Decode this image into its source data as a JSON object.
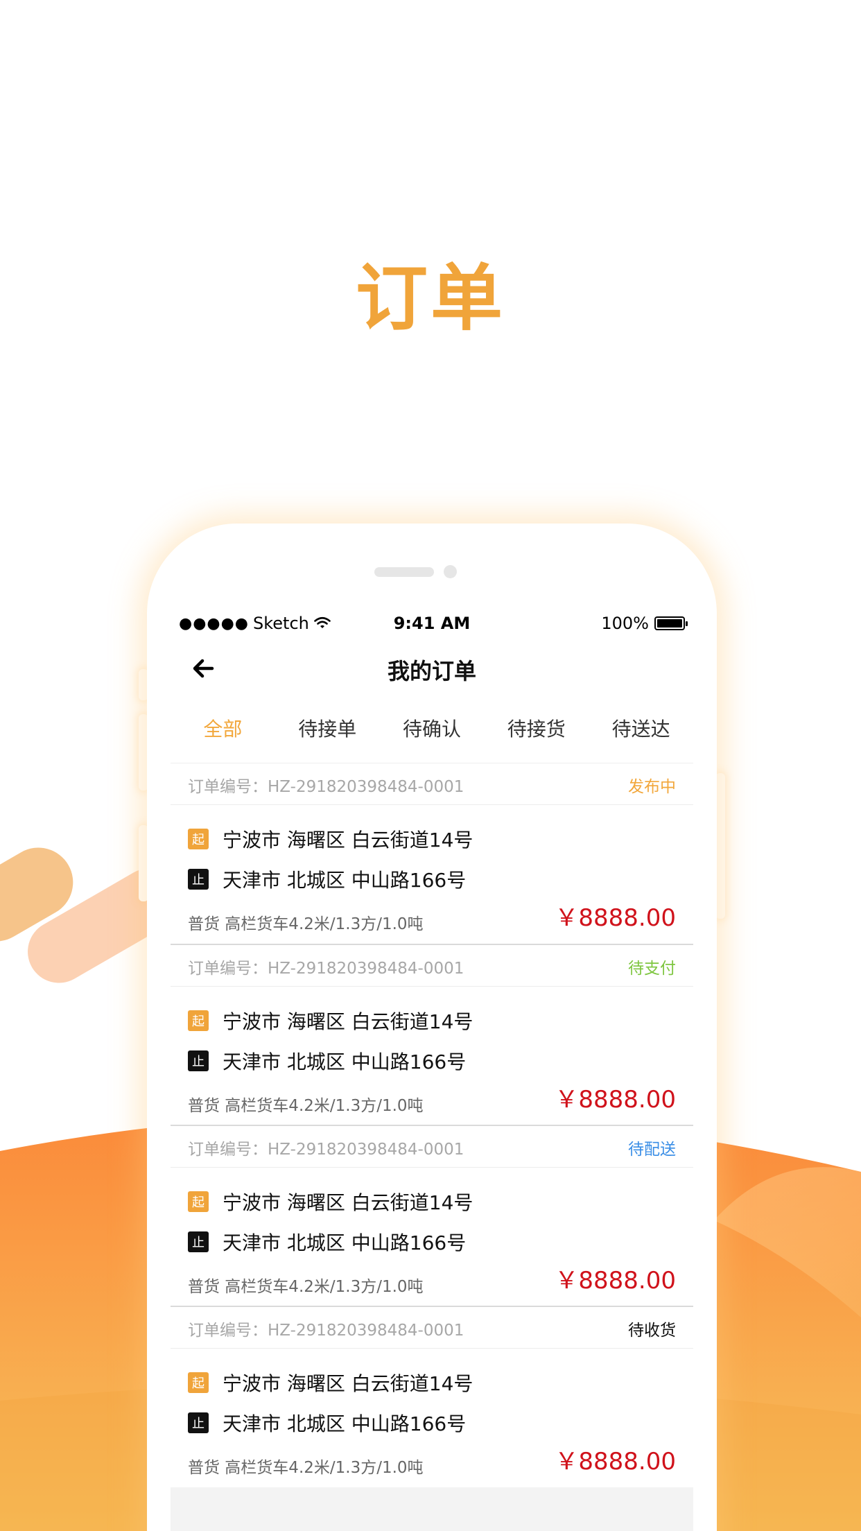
{
  "hero": {
    "title": "订单"
  },
  "status_bar": {
    "carrier": "Sketch",
    "signal_dots": "●●●●●",
    "time": "9:41 AM",
    "battery": "100%"
  },
  "nav": {
    "title": "我的订单",
    "back_icon": "arrow-left-icon"
  },
  "tabs": [
    {
      "label": "全部",
      "active": true
    },
    {
      "label": "待接单"
    },
    {
      "label": "待确认"
    },
    {
      "label": "待接货"
    },
    {
      "label": "待送达"
    }
  ],
  "orders": [
    {
      "number": "订单编号：HZ-291820398484-0001",
      "status": "发布中",
      "status_color": "#f2a73b",
      "start_tag": "起",
      "start_address": "宁波市 海曙区 白云街道14号",
      "end_tag": "止",
      "end_address": "天津市 北城区 中山路166号",
      "cargo": "普货 高栏货车4.2米/1.3方/1.0吨",
      "price": "￥8888.00"
    },
    {
      "number": "订单编号：HZ-291820398484-0001",
      "status": "待支付",
      "status_color": "#7ec640",
      "start_tag": "起",
      "start_address": "宁波市 海曙区 白云街道14号",
      "end_tag": "止",
      "end_address": "天津市 北城区 中山路166号",
      "cargo": "普货 高栏货车4.2米/1.3方/1.0吨",
      "price": "￥8888.00"
    },
    {
      "number": "订单编号：HZ-291820398484-0001",
      "status": "待配送",
      "status_color": "#3a8ee6",
      "start_tag": "起",
      "start_address": "宁波市 海曙区 白云街道14号",
      "end_tag": "止",
      "end_address": "天津市 北城区 中山路166号",
      "cargo": "普货 高栏货车4.2米/1.3方/1.0吨",
      "price": "￥8888.00"
    },
    {
      "number": "订单编号：HZ-291820398484-0001",
      "status": "待收货",
      "status_color": "#111111",
      "start_tag": "起",
      "start_address": "宁波市 海曙区 白云街道14号",
      "end_tag": "止",
      "end_address": "天津市 北城区 中山路166号",
      "cargo": "普货 高栏货车4.2米/1.3方/1.0吨",
      "price": "￥8888.00"
    }
  ],
  "colors": {
    "accent": "#f0a43a",
    "price": "#d0121b",
    "wave_top": "#fb8a3a",
    "wave_bottom": "#f7c15c"
  }
}
